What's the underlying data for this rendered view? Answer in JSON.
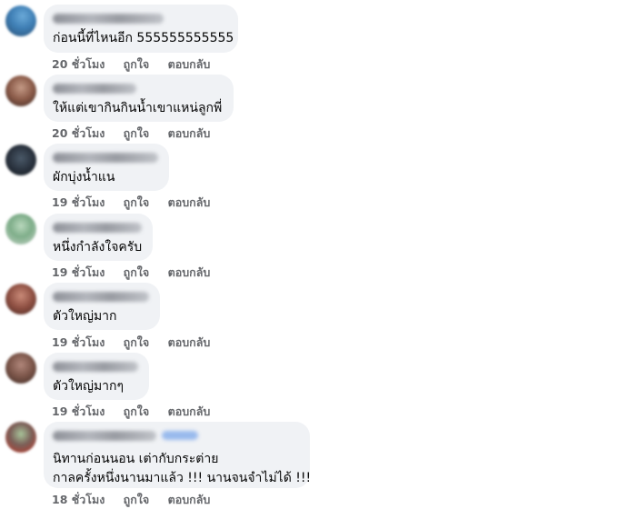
{
  "actions": {
    "like_label": "ถูกใจ",
    "reply_label": "ตอบกลับ"
  },
  "comments": [
    {
      "text_lines": [
        "ก่อนนี้ที่ไหนอีก 555555555555"
      ],
      "time": "20 ชั่วโมง"
    },
    {
      "text_lines": [
        "ให้แต่เขากินกินน้ำเขาแหน่ลูกพี่"
      ],
      "time": "20 ชั่วโมง"
    },
    {
      "text_lines": [
        "ผักบุ่งน้ำแน"
      ],
      "time": "19 ชั่วโมง"
    },
    {
      "text_lines": [
        "หนึ่งกำลังใจครับ"
      ],
      "time": "19 ชั่วโมง"
    },
    {
      "text_lines": [
        "ตัวใหญ่มาก"
      ],
      "time": "19 ชั่วโมง"
    },
    {
      "text_lines": [
        "ตัวใหญ่มากๆ"
      ],
      "time": "19 ชั่วโมง"
    },
    {
      "text_lines": [
        "นิทานก่อนนอน เต่ากับกระต่าย",
        "กาลครั้งหนึ่งนานมาแล้ว !!! นานจนจำไม่ได้ !!!"
      ],
      "time": "18 ชั่วโมง"
    }
  ]
}
